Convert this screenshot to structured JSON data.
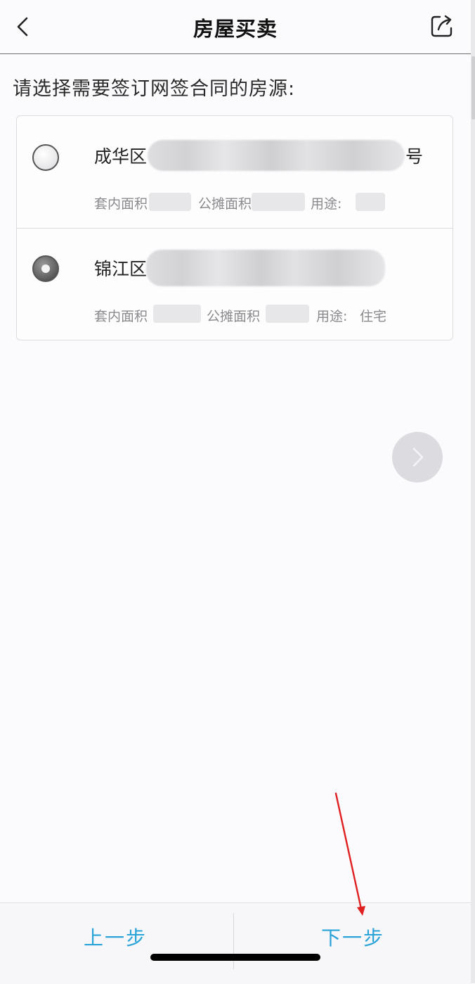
{
  "header": {
    "title": "房屋买卖",
    "back_icon": "chevron-left-icon",
    "share_icon": "share-icon"
  },
  "prompt": "请选择需要签订网签合同的房源:",
  "properties": [
    {
      "district": "成华区",
      "address_tail": "号",
      "inner_area_label": "套内面积",
      "shared_area_label": "公摊面积",
      "usage_label": "用途:",
      "usage_value": "",
      "selected": false
    },
    {
      "district": "锦江区",
      "address_tail": "",
      "inner_area_label": "套内面积",
      "shared_area_label": "公摊面积",
      "usage_label": "用途:",
      "usage_value": "住宅",
      "selected": true
    }
  ],
  "next_arrow_icon": "chevron-right-icon",
  "footer": {
    "prev_label": "上一步",
    "next_label": "下一步"
  },
  "colors": {
    "accent": "#2aa3d8",
    "annotation": "#e02020"
  }
}
